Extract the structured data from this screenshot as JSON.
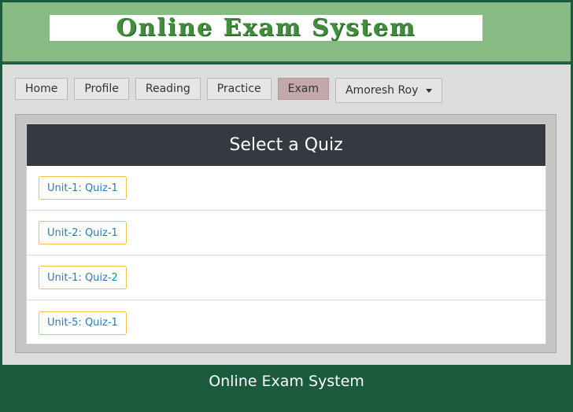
{
  "header": {
    "logo_text": "Online Exam System"
  },
  "nav": {
    "items": [
      {
        "label": "Home"
      },
      {
        "label": "Profile"
      },
      {
        "label": "Reading"
      },
      {
        "label": "Practice"
      },
      {
        "label": "Exam",
        "active": true
      }
    ],
    "user_menu": {
      "label": "Amoresh Roy"
    }
  },
  "main": {
    "title": "Select a Quiz",
    "quizzes": [
      {
        "label": "Unit-1: Quiz-1"
      },
      {
        "label": "Unit-2: Quiz-1"
      },
      {
        "label": "Unit-1: Quiz-2"
      },
      {
        "label": "Unit-5: Quiz-1"
      }
    ]
  },
  "footer": {
    "text": "Online Exam System"
  },
  "colors": {
    "header_bg": "#88bb84",
    "footer_bg": "#1c5a3c",
    "card_header_bg": "#343a40",
    "active_tab_bg": "#c2a8a8",
    "quiz_border": "#f0c040",
    "quiz_text": "#2a7ab8"
  }
}
